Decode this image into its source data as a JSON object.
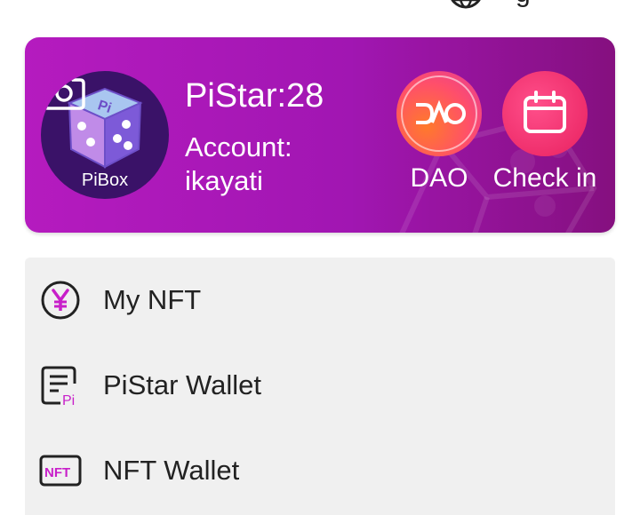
{
  "top_bar": {
    "globe_icon": "globe-icon",
    "partial_text": "g"
  },
  "profile": {
    "avatar_brand": "PiBox",
    "avatar_icon": "dice-icon",
    "camera_icon": "camera-icon",
    "pistar": "PiStar:28",
    "account_label": "Account:",
    "account_name": "ikayati"
  },
  "actions": [
    {
      "label": "DAO",
      "icon": "dao-icon"
    },
    {
      "label": "Check in",
      "icon": "calendar-icon"
    }
  ],
  "menu": [
    {
      "label": "My NFT",
      "icon": "yen-circle-icon"
    },
    {
      "label": "PiStar Wallet",
      "icon": "wallet-document-icon"
    },
    {
      "label": "NFT Wallet",
      "icon": "nft-badge-icon"
    }
  ],
  "colors": {
    "card_gradient_start": "#b51bbf",
    "card_gradient_end": "#85107f",
    "accent_magenta": "#c81fc9",
    "menu_background": "#f0f0f0"
  }
}
